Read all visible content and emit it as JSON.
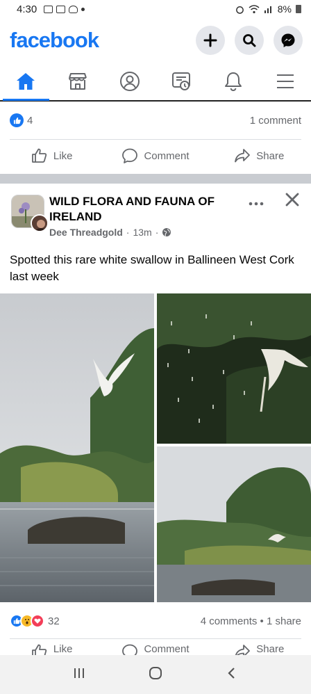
{
  "status_bar": {
    "time": "4:30",
    "battery": "8%"
  },
  "header": {
    "logo": "facebook"
  },
  "nav_tabs": [
    "home",
    "marketplace",
    "profile",
    "watch",
    "notifications",
    "menu"
  ],
  "prev_post": {
    "reaction_count": "4",
    "comments": "1 comment",
    "actions": {
      "like": "Like",
      "comment": "Comment",
      "share": "Share"
    }
  },
  "post": {
    "group": "WILD FLORA AND FAUNA OF IRELAND",
    "author": "Dee Threadgold",
    "time": "13m",
    "dot": "·",
    "text": "Spotted this rare white swallow in Ballineen West Cork last week",
    "reaction_count": "32",
    "comments_shares": "4 comments • 1 share",
    "actions": {
      "like": "Like",
      "comment": "Comment",
      "share": "Share"
    }
  },
  "colors": {
    "brand": "#1877f2",
    "muted": "#65676b",
    "band": "#c9ccd1"
  },
  "icons": {
    "create": "plus-icon",
    "search": "search-icon",
    "messenger": "messenger-icon",
    "more": "more-horizontal-icon",
    "close": "close-icon",
    "privacy": "globe-icon"
  }
}
